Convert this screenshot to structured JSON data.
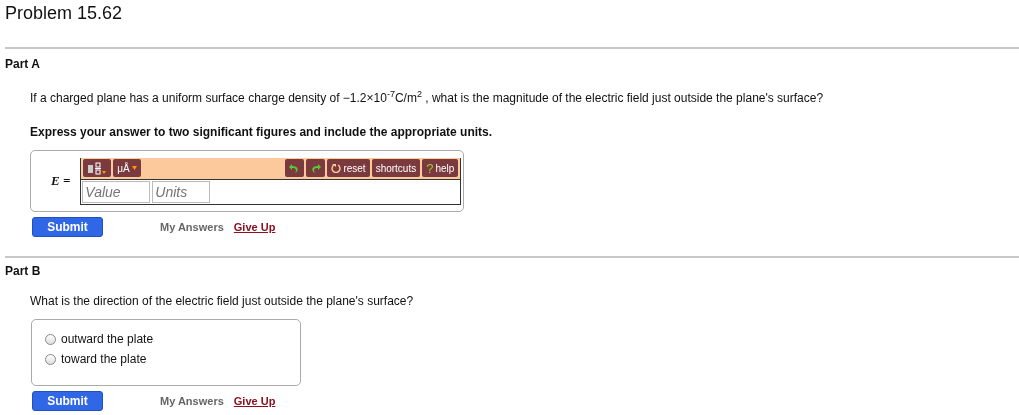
{
  "title": "Problem 15.62",
  "parts": [
    {
      "kind": "units",
      "label": "Part A",
      "question": "If a charged plane has a uniform surface charge density of −1.2×10$^{-7}$C/m$^{2}$ , what is the magnitude of the electric field just outside the plane's surface?",
      "instruction": "Express your answer to two significant figures and include the appropriate units.",
      "variable": "E =",
      "toolbar": {
        "units_label": "μÅ",
        "reset": "reset",
        "shortcuts": "shortcuts",
        "help_mark": "?",
        "help": "help"
      },
      "value_placeholder": "Value",
      "units_placeholder": "Units",
      "submit": "Submit",
      "my_answers": "My Answers",
      "give_up": "Give Up"
    },
    {
      "kind": "radio",
      "label": "Part B",
      "question": "What is the direction of the electric field just outside the plane's surface?",
      "options": [
        {
          "label": "outward the plate",
          "selected": false
        },
        {
          "label": "toward the plate",
          "selected": false
        }
      ],
      "submit": "Submit",
      "my_answers": "My Answers",
      "give_up": "Give Up"
    }
  ]
}
